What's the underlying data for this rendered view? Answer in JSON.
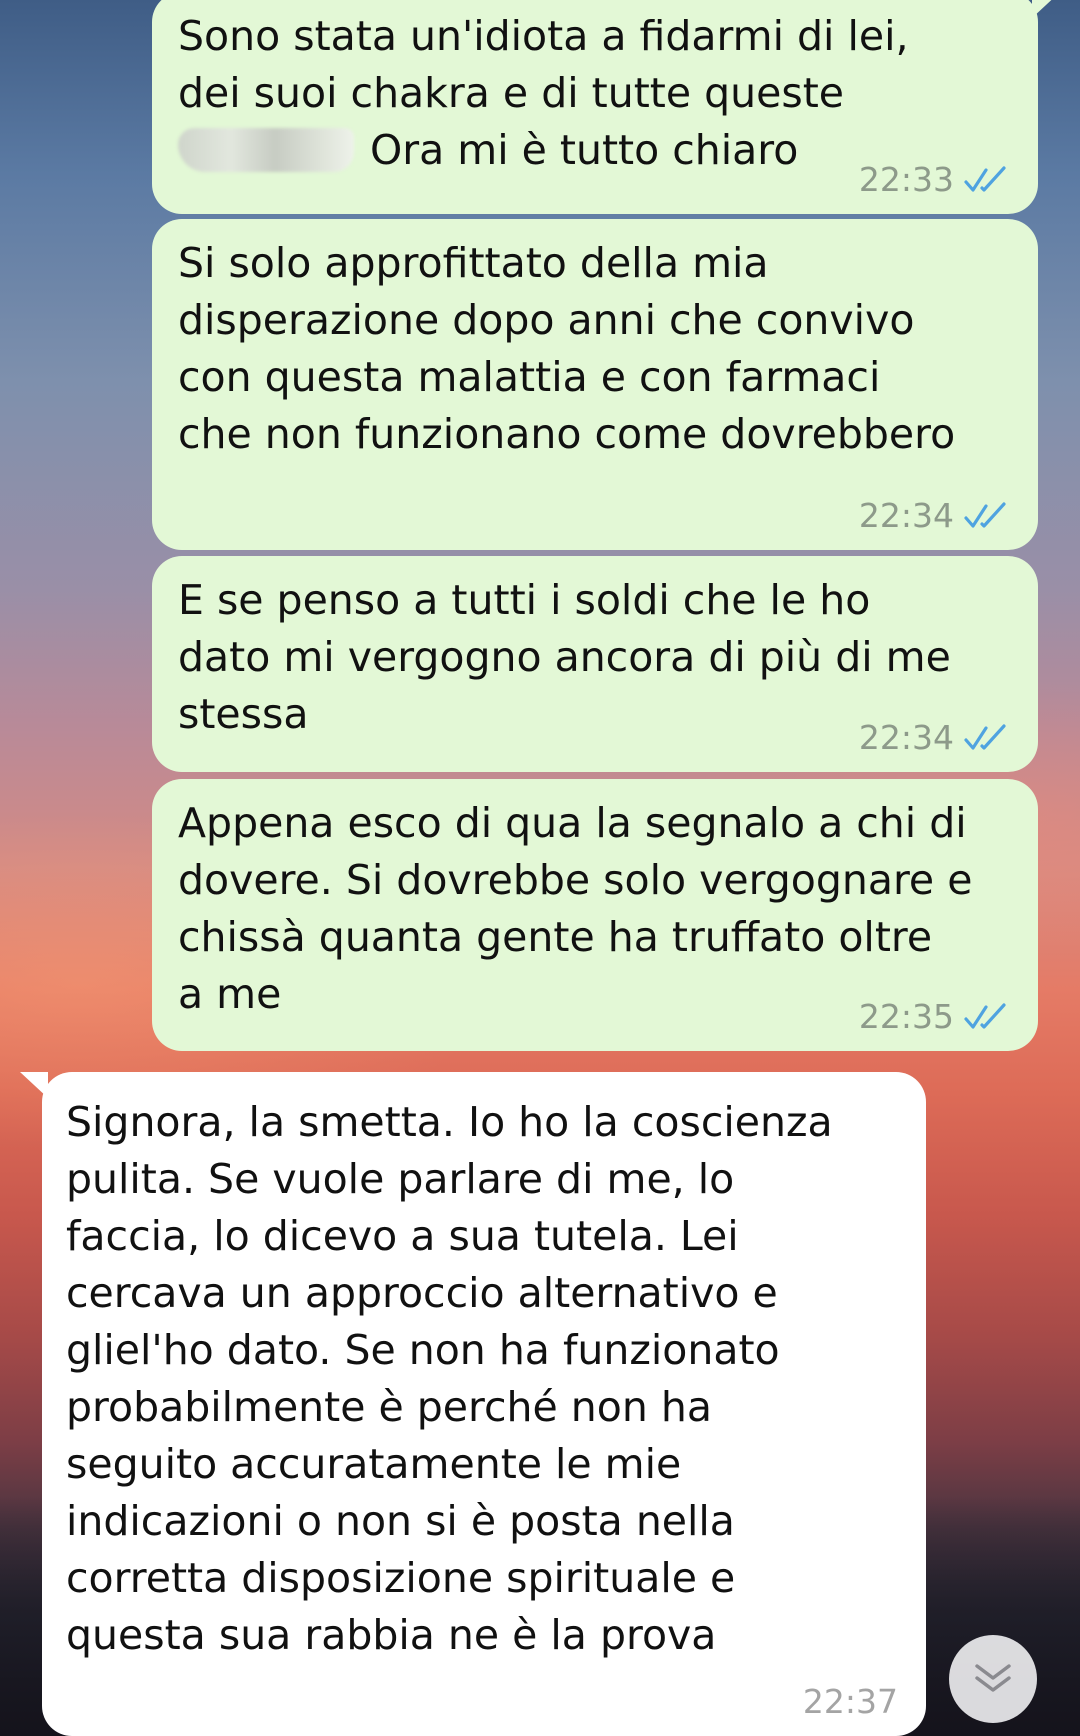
{
  "messages": [
    {
      "direction": "outgoing",
      "lines_before_redaction": "Sono stata un'idiota a fidarmi di lei,\ndei suoi chakra e di tutte queste",
      "text_after_redaction": "Ora mi è tutto chiaro",
      "time": "22:33",
      "status": "read"
    },
    {
      "direction": "outgoing",
      "text": "Si solo approfittato della mia\ndisperazione dopo anni che convivo\ncon questa malattia e con farmaci\nche non funzionano come dovrebbero",
      "time": "22:34",
      "status": "read"
    },
    {
      "direction": "outgoing",
      "text": "E se penso a tutti i soldi che le ho\ndato mi vergogno ancora di più di me\nstessa",
      "time": "22:34",
      "status": "read"
    },
    {
      "direction": "outgoing",
      "text": "Appena esco di qua la segnalo a chi di\ndovere. Si dovrebbe solo vergognare e\nchissà quanta gente ha truffato oltre\na me",
      "time": "22:35",
      "status": "read"
    },
    {
      "direction": "incoming",
      "text": "Signora, la smetta. Io ho la coscienza\npulita. Se vuole parlare di me, lo\nfaccia, lo dicevo a sua tutela. Lei\ncercava un approccio alternativo e\ngliel'ho dato. Se non ha funzionato\nprobabilmente è perché non ha\nseguito accuratamente le mie\nindicazioni o non si è posta nella\ncorretta disposizione spirituale e\nquesta sua rabbia ne è la prova",
      "time": "22:37"
    }
  ],
  "icons": {
    "read_receipt": "double-check-icon",
    "scroll_down": "chevron-double-down-icon"
  },
  "colors": {
    "outgoing_bubble": "#e3f8d6",
    "incoming_bubble": "#ffffff",
    "read_ticks": "#4fa3e0",
    "timestamp": "#8d9a8a"
  }
}
